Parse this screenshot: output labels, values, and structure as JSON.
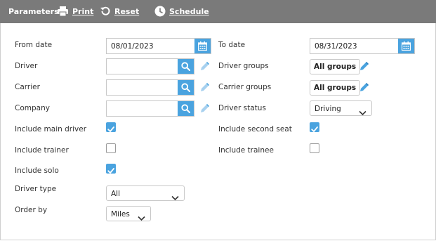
{
  "toolbar": {
    "title": "Parameters",
    "print_label": "Print",
    "reset_label": "Reset",
    "schedule_label": "Schedule"
  },
  "form": {
    "from_date": {
      "label": "From date",
      "value": "08/01/2023"
    },
    "to_date": {
      "label": "To date",
      "value": "08/31/2023"
    },
    "driver": {
      "label": "Driver",
      "value": ""
    },
    "carrier": {
      "label": "Carrier",
      "value": ""
    },
    "company": {
      "label": "Company",
      "value": ""
    },
    "driver_groups": {
      "label": "Driver groups",
      "button": "All groups"
    },
    "carrier_groups": {
      "label": "Carrier groups",
      "button": "All groups"
    },
    "driver_status": {
      "label": "Driver status",
      "value": "Driving"
    },
    "include_main_driver": {
      "label": "Include main driver",
      "checked": true
    },
    "include_second_seat": {
      "label": "Include second seat",
      "checked": true
    },
    "include_trainer": {
      "label": "Include trainer",
      "checked": false
    },
    "include_trainee": {
      "label": "Include trainee",
      "checked": false
    },
    "include_solo": {
      "label": "Include solo",
      "checked": true
    },
    "driver_type": {
      "label": "Driver type",
      "value": "All"
    },
    "order_by": {
      "label": "Order by",
      "value": "Miles"
    }
  },
  "colors": {
    "toolbar_bg": "#7a7a7a",
    "accent": "#4aa3df",
    "pencil": "#4aa3df"
  },
  "icons": {
    "print": "printer-icon",
    "reset": "undo-icon",
    "schedule": "clock-icon",
    "calendar": "calendar-icon",
    "search": "search-icon",
    "edit": "pencil-icon",
    "dropdown": "chevron-down-icon",
    "check": "check-icon"
  }
}
